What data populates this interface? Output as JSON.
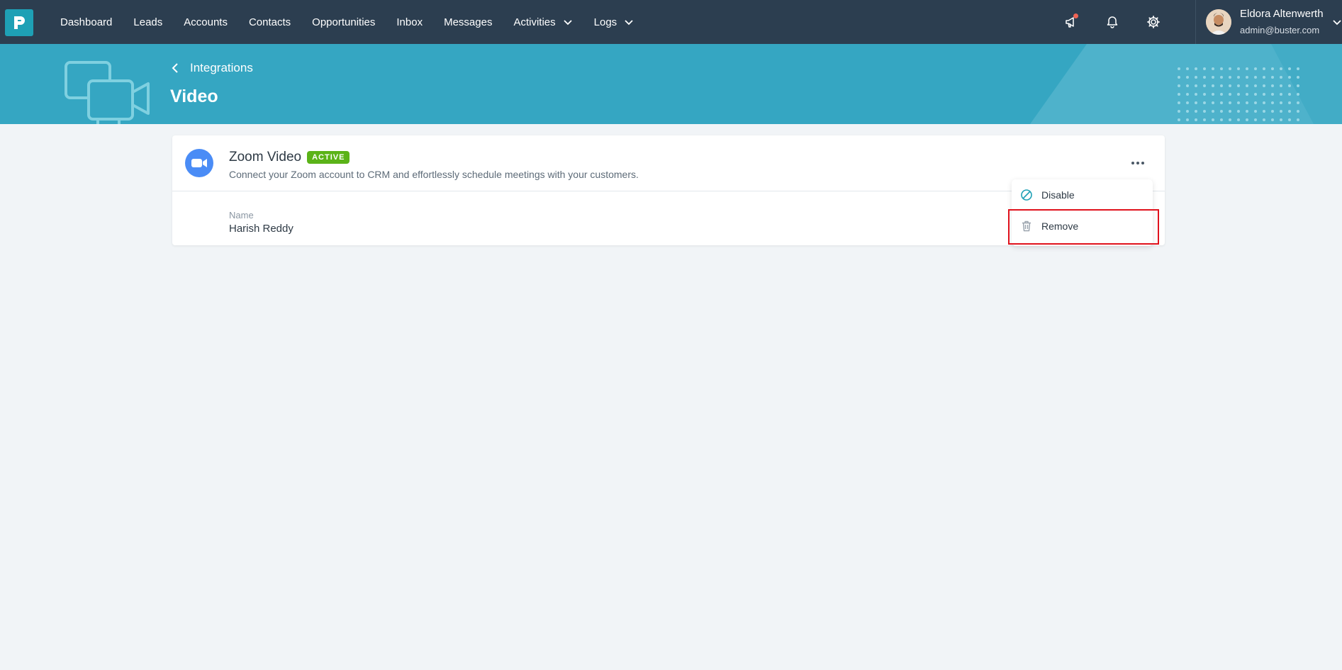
{
  "nav": {
    "items": [
      {
        "label": "Dashboard"
      },
      {
        "label": "Leads"
      },
      {
        "label": "Accounts"
      },
      {
        "label": "Contacts"
      },
      {
        "label": "Opportunities"
      },
      {
        "label": "Inbox"
      },
      {
        "label": "Messages"
      },
      {
        "label": "Activities",
        "has_dropdown": true
      },
      {
        "label": "Logs",
        "has_dropdown": true
      }
    ],
    "icons": [
      "megaphone-icon",
      "bell-icon",
      "gear-icon"
    ]
  },
  "user": {
    "name": "Eldora Altenwerth",
    "email": "admin@buster.com"
  },
  "banner": {
    "breadcrumb": "Integrations",
    "title": "Video"
  },
  "integration": {
    "name": "Zoom Video",
    "status": "ACTIVE",
    "description": "Connect your Zoom account to CRM and effortlessly schedule meetings with your customers.",
    "field_label": "Name",
    "field_value": "Harish Reddy"
  },
  "menu": {
    "disable_label": "Disable",
    "remove_label": "Remove"
  },
  "colors": {
    "nav_bg": "#2c3e50",
    "banner_bg": "#35a6c2",
    "badge_active": "#5bb318",
    "zoom_blue": "#4a8cf6",
    "highlight_red": "#e0121d"
  }
}
